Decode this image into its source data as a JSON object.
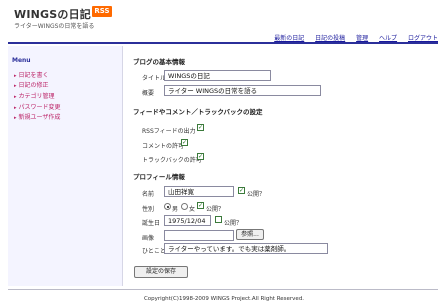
{
  "header": {
    "site_title": "WINGSの日記",
    "rss_badge": "RSS",
    "tagline": "ライターWINGSの日常を語る",
    "nav": [
      "最新の日記",
      "日記の投稿",
      "管理",
      "ヘルプ",
      "ログアウト"
    ]
  },
  "sidebar": {
    "heading": "Menu",
    "items": [
      "日記を書く",
      "日記の修正",
      "カテゴリ管理",
      "パスワード変更",
      "新規ユーザ作成"
    ]
  },
  "basic": {
    "section_title": "ブログの基本情報",
    "title_label": "タイトル",
    "title_value": "WINGSの日記",
    "summary_label": "概要",
    "summary_value": "ライター WINGSの日常を語る"
  },
  "feed": {
    "section_title": "フィードやコメント／トラックバックの設定",
    "rss_label": "RSSフィードの出力",
    "rss_checked": true,
    "comment_label": "コメントの許可",
    "comment_checked": true,
    "trackback_label": "トラックバックの許可",
    "trackback_checked": true
  },
  "profile": {
    "section_title": "プロフィール情報",
    "name_label": "名前",
    "name_value": "山田祥寛",
    "name_public_label": "公開？",
    "name_public_checked": true,
    "gender_label": "性別",
    "gender_male": "男",
    "gender_female": "女",
    "gender_selected": "male",
    "gender_public_label": "公開？",
    "gender_public_checked": true,
    "birthday_label": "誕生日",
    "birthday_value": "1975/12/04",
    "birthday_public_label": "公開？",
    "birthday_public_checked": false,
    "image_label": "画像",
    "image_value": "",
    "browse_label": "参照...",
    "message_label": "ひとこと",
    "message_value": "ライターやっています。でも実は薬剤師。"
  },
  "save_label": "設定の保存",
  "footer": {
    "copyright": "Copyright(C)1998-2009 WINGS Project.All Right Reserved."
  }
}
